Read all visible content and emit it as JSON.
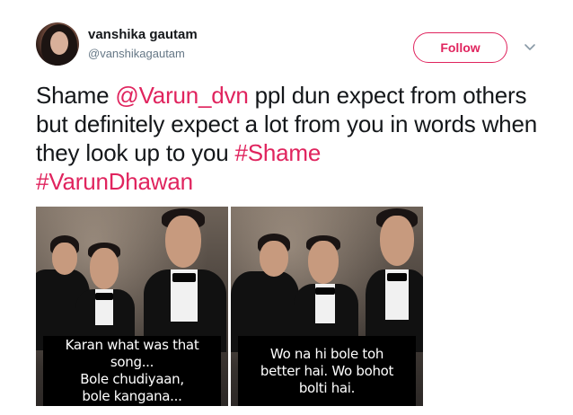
{
  "user": {
    "name": "vanshika gautam",
    "handle": "@vanshikagautam"
  },
  "actions": {
    "follow_label": "Follow"
  },
  "tweet": {
    "t1": "Shame ",
    "mention": "@Varun_dvn",
    "t2": " ppl dun expect from others but definitely expect a lot from you in words when they look up to you ",
    "hashtag1": "#Shame",
    "hashtag2": "#VarunDhawan"
  },
  "media": {
    "left_caption": "Karan what was that song...\nBole chudiyaan,\nbole kangana...",
    "right_caption": "Wo na hi bole toh\nbetter hai. Wo bohot\nbolti hai."
  },
  "colors": {
    "accent": "#e0245e",
    "text": "#14171a",
    "muted": "#657786"
  },
  "icons": {
    "menu": "chevron-down-icon"
  }
}
